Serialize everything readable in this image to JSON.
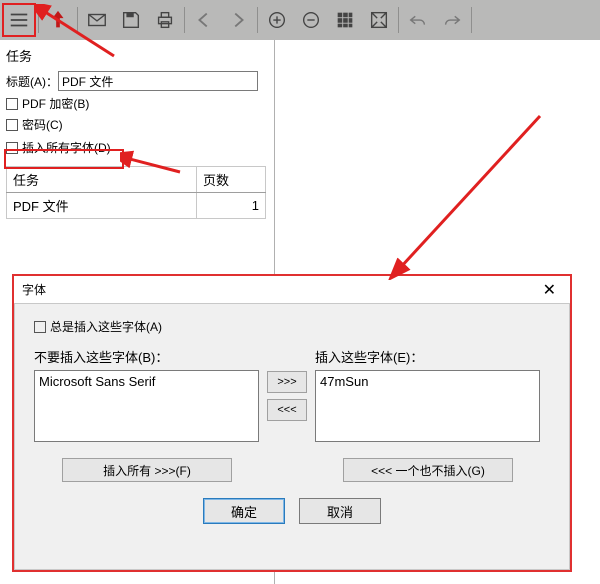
{
  "toolbar": {
    "icons": [
      "menu",
      "pdf",
      "mail",
      "save",
      "print",
      "back",
      "forward",
      "zoom-in",
      "zoom-out",
      "grid",
      "fit",
      "undo",
      "redo"
    ]
  },
  "sidebar": {
    "section_label": "任务",
    "title_label": "标题(A)：",
    "title_value": "PDF 文件",
    "pdf_encrypt_label": "PDF 加密(B)",
    "password_label": "密码(C)",
    "insert_all_fonts_label": "插入所有字体(D)",
    "table": {
      "col1": "任务",
      "col2": "页数",
      "row1_name": "PDF 文件",
      "row1_pages": "1"
    }
  },
  "dialog": {
    "title": "字体",
    "always_insert_label": "总是插入这些字体(A)",
    "dont_insert_label": "不要插入这些字体(B)：",
    "insert_label": "插入这些字体(E)：",
    "dont_insert_item": "Microsoft Sans Serif",
    "insert_item": "47mSun",
    "move_right": ">>>",
    "move_left": "<<<",
    "insert_all_btn": "插入所有 >>>(F)",
    "insert_none_btn": "<<<  一个也不插入(G)",
    "ok": "确定",
    "cancel": "取消"
  },
  "annotation_color": "#e02020"
}
